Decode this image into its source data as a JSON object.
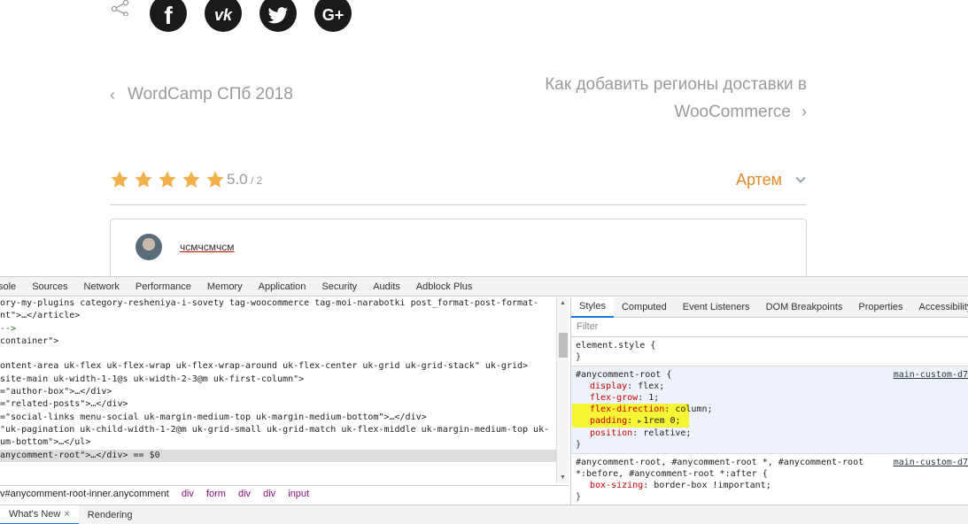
{
  "page": {
    "social": {
      "share_icon": "share-icon",
      "facebook_letter": "f",
      "vk_letters": "vk",
      "gplus_letters": "G+"
    },
    "nav": {
      "prev_label": "WordCamp СПб 2018",
      "next_label_line1": "Как добавить регионы доставки в",
      "next_label_line2": "WooCommerce"
    },
    "rating": {
      "value": "5.0",
      "count": "2",
      "stars_filled": 5,
      "star_color": "#f0b14a"
    },
    "author": {
      "name": "Артем",
      "color": "#e08a2a"
    },
    "comment": {
      "username": "чсмчсмчсм"
    }
  },
  "devtools": {
    "tabs": [
      "sole",
      "Sources",
      "Network",
      "Performance",
      "Memory",
      "Application",
      "Security",
      "Audits",
      "Adblock Plus"
    ],
    "elements_lines": [
      "ory-my-plugins category-resheniya-i-sovety tag-woocommerce tag-moi-narabotki post_format-post-format-",
      "nt\">…</article>",
      " -->",
      "container\">",
      "",
      "ontent-area uk-flex uk-flex-wrap uk-flex-wrap-around uk-flex-center uk-grid uk-grid-stack\" uk-grid>",
      "site-main uk-width-1-1@s uk-width-2-3@m uk-first-column\">",
      "=\"author-box\">…</div>",
      "=\"related-posts\">…</div>",
      "=\"social-links menu-social uk-margin-medium-top uk-margin-medium-bottom\">…</div>",
      " \"uk-pagination uk-child-width-1-2@m uk-grid-small uk-grid-match uk-flex-middle uk-margin-medium-top uk-",
      "um-bottom\">…</ul>",
      "anycomment-root\">…</div> == $0"
    ],
    "breadcrumbs": [
      "v#anycomment-root-inner.anycomment",
      "div",
      "form",
      "div",
      "div",
      "input"
    ],
    "styles_tabs": [
      "Styles",
      "Computed",
      "Event Listeners",
      "DOM Breakpoints",
      "Properties",
      "Accessibility"
    ],
    "filter_placeholder": "Filter",
    "element_style": "element.style {",
    "rule1": {
      "selector": "#anycomment-root {",
      "source": "main-custom-d7",
      "declarations": [
        {
          "prop": "display",
          "val": "flex;"
        },
        {
          "prop": "flex-grow",
          "val": "1;"
        },
        {
          "prop": "flex-direction",
          "val": "column;"
        },
        {
          "prop": "padding",
          "val": "1rem 0;"
        },
        {
          "prop": "position",
          "val": "relative;"
        }
      ]
    },
    "rule2": {
      "selector_line1": "#anycomment-root, #anycomment-root *, #anycomment-root",
      "selector_line2": "*:before, #anycomment-root *:after {",
      "source": "main-custom-d7",
      "declaration": {
        "prop": "box-sizing",
        "val": "border-box !important;"
      }
    },
    "drawer_tabs": [
      "What's New",
      "Rendering"
    ],
    "close_glyph": "×",
    "closing_brace": "}"
  }
}
